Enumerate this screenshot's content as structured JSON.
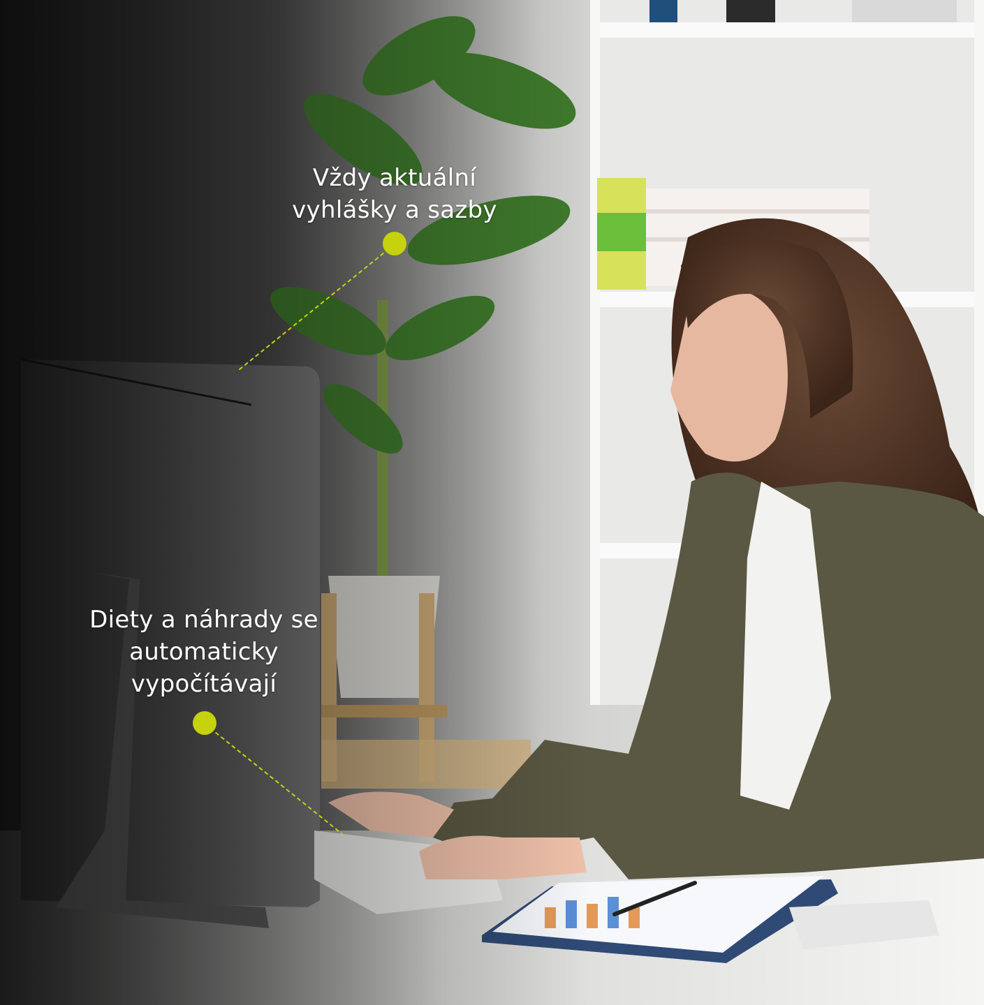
{
  "callouts": [
    {
      "lines": [
        "Vždy aktuální",
        "vyhlášky a sazby"
      ]
    },
    {
      "lines": [
        "Diety a náhrady se",
        "automaticky",
        "vypočítávají"
      ]
    }
  ],
  "colors": {
    "accent": "#c5d20c",
    "text": "#ffffff"
  }
}
